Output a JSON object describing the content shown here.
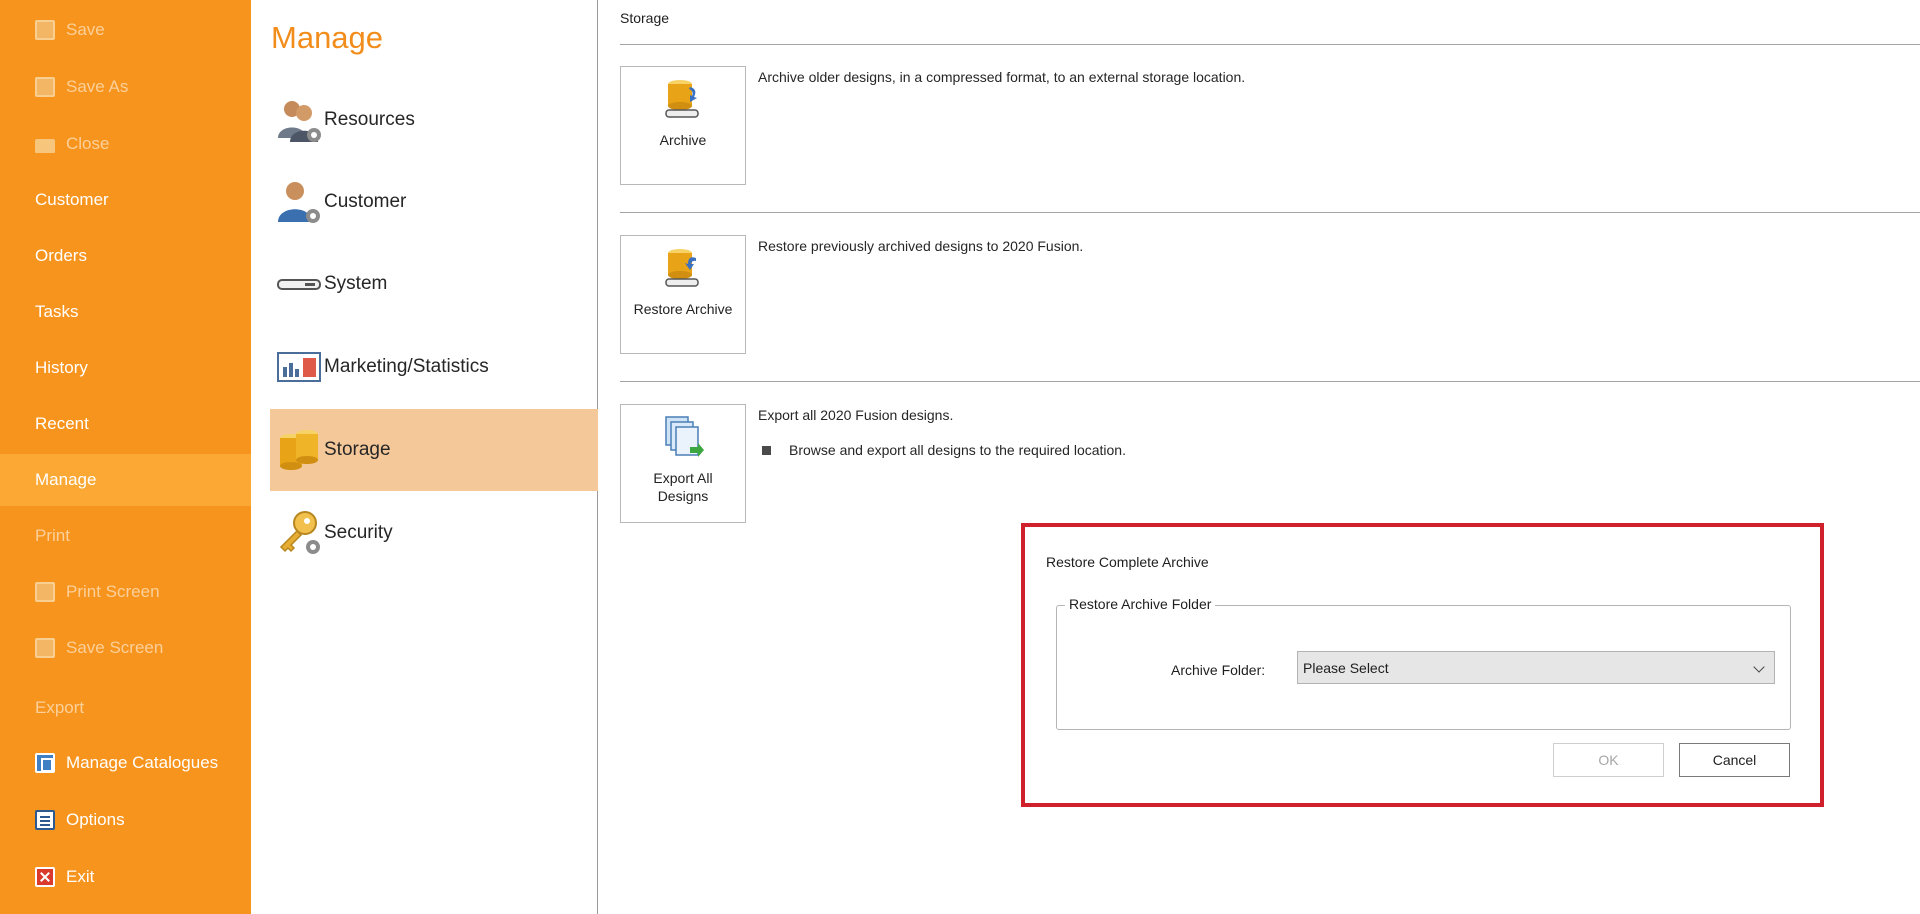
{
  "nav": {
    "items": [
      {
        "label": "Save",
        "icon": "save-icon",
        "state": "disabled"
      },
      {
        "label": "Save As",
        "icon": "save-as-icon",
        "state": "disabled"
      },
      {
        "label": "Close",
        "icon": "folder-icon",
        "state": "disabled"
      },
      {
        "label": "Customer",
        "state": "normal"
      },
      {
        "label": "Orders",
        "state": "normal"
      },
      {
        "label": "Tasks",
        "state": "normal"
      },
      {
        "label": "History",
        "state": "normal"
      },
      {
        "label": "Recent",
        "state": "normal"
      },
      {
        "label": "Manage",
        "state": "active"
      },
      {
        "label": "Print",
        "state": "disabled"
      },
      {
        "label": "Print Screen",
        "icon": "print-screen-icon",
        "state": "disabled"
      },
      {
        "label": "Save Screen",
        "icon": "save-screen-icon",
        "state": "disabled"
      },
      {
        "label": "Export",
        "state": "disabled"
      },
      {
        "label": "Manage Catalogues",
        "icon": "catalogue-icon",
        "state": "normal"
      },
      {
        "label": "Options",
        "icon": "options-icon",
        "state": "normal"
      },
      {
        "label": "Exit",
        "icon": "exit-icon",
        "state": "normal"
      }
    ]
  },
  "manage": {
    "title": "Manage",
    "items": [
      {
        "label": "Resources",
        "icon": "resources-icon"
      },
      {
        "label": "Customer",
        "icon": "customer-icon"
      },
      {
        "label": "System",
        "icon": "system-icon"
      },
      {
        "label": "Marketing/Statistics",
        "icon": "marketing-icon"
      },
      {
        "label": "Storage",
        "icon": "storage-icon",
        "active": true
      },
      {
        "label": "Security",
        "icon": "security-icon"
      }
    ]
  },
  "main": {
    "section_title": "Storage",
    "archive": {
      "label": "Archive",
      "description": "Archive older designs, in a compressed format, to an external storage location."
    },
    "restore": {
      "label": "Restore Archive",
      "description": "Restore previously archived designs to 2020 Fusion."
    },
    "export": {
      "label_line1": "Export All",
      "label_line2": "Designs",
      "description": "Export all 2020 Fusion designs.",
      "bullet": "Browse and export all designs to the required location."
    }
  },
  "dialog": {
    "title": "Restore Complete Archive",
    "group_title": "Restore Archive Folder",
    "folder_label": "Archive Folder:",
    "folder_value": "Please Select",
    "ok_label": "OK",
    "cancel_label": "Cancel"
  },
  "colors": {
    "nav_bg": "#f7941d",
    "nav_active": "#fba934",
    "manage_title": "#f28c1a",
    "manage_active": "#f5c89a",
    "highlight_border": "#d0202c"
  }
}
